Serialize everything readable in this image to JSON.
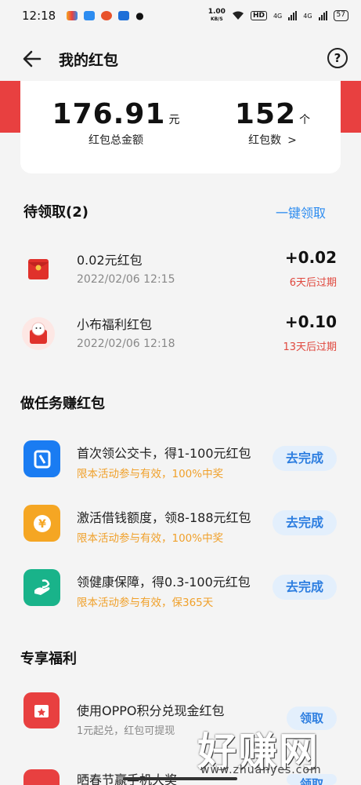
{
  "status": {
    "time": "12:18",
    "net_speed_value": "1.00",
    "net_speed_unit": "KB/S",
    "hd": "HD",
    "sig1": "4G",
    "sig2": "4G",
    "battery": "57"
  },
  "header": {
    "title": "我的红包",
    "help": "?"
  },
  "summary": {
    "total_value": "176.91",
    "total_unit": "元",
    "total_label": "红包总金额",
    "count_value": "152",
    "count_unit": "个",
    "count_label": "红包数"
  },
  "pending": {
    "title": "待领取(2)",
    "claim_all": "一键领取",
    "items": [
      {
        "title": "0.02元红包",
        "time": "2022/02/06 12:15",
        "amount": "+0.02",
        "expire": "6天后过期"
      },
      {
        "title": "小布福利红包",
        "time": "2022/02/06 12:18",
        "amount": "+0.10",
        "expire": "13天后过期"
      }
    ]
  },
  "tasks": {
    "title": "做任务赚红包",
    "items": [
      {
        "title": "首次领公交卡，得1-100元红包",
        "sub": "限本活动参与有效，100%中奖",
        "action": "去完成",
        "icon_color": "#1a7cf2",
        "icon": "bus-card-icon"
      },
      {
        "title": "激活借钱额度，领8-188元红包",
        "sub": "限本活动参与有效，100%中奖",
        "action": "去完成",
        "icon_color": "#f5a623",
        "icon": "yuan-coin-icon"
      },
      {
        "title": "领健康保障，得0.3-100元红包",
        "sub": "限本活动参与有效，保365天",
        "action": "去完成",
        "icon_color": "#19b38a",
        "icon": "health-hand-icon"
      }
    ]
  },
  "benefits": {
    "title": "专享福利",
    "items": [
      {
        "title": "使用OPPO积分兑现金红包",
        "sub": "1元起兑，红包可提现",
        "action": "领取"
      },
      {
        "title": "晒春节赢手机大奖",
        "sub": "",
        "action": "领取"
      }
    ]
  },
  "watermark": {
    "text": "好赚网",
    "url": "www.zhuanyes.com"
  }
}
